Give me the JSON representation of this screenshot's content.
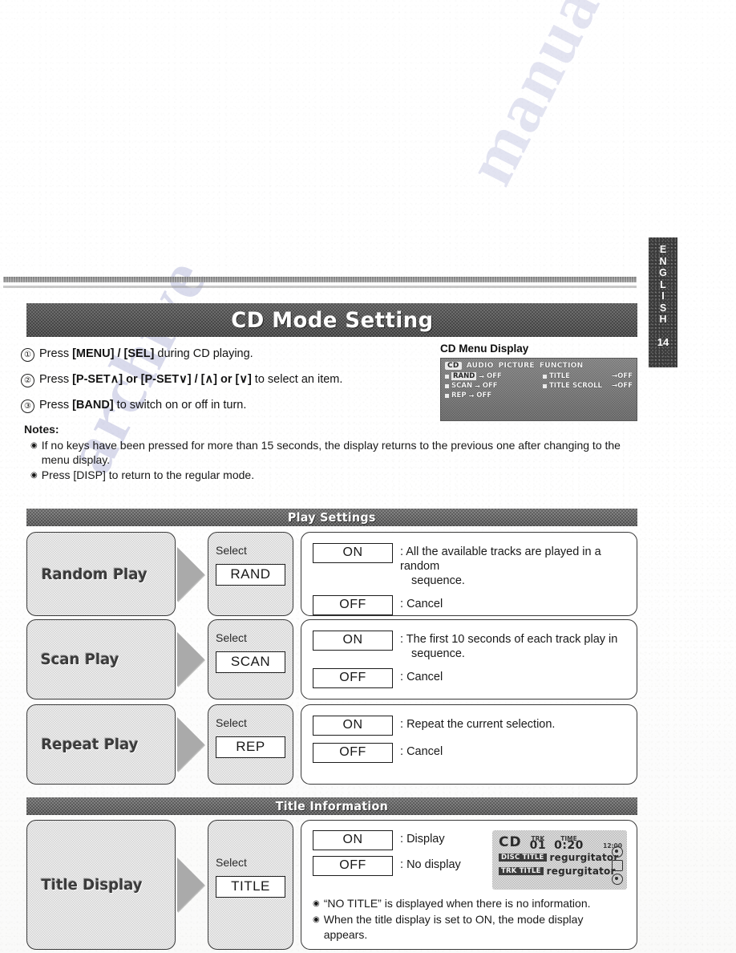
{
  "side_tab": {
    "language": "ENGLISH",
    "letters": [
      "E",
      "N",
      "G",
      "L",
      "I",
      "S",
      "H"
    ],
    "page_number": "14"
  },
  "watermark": {
    "text_left": "archive",
    "text_right": "manualshive.com"
  },
  "header": {
    "title": "CD Mode Setting"
  },
  "steps": [
    {
      "num": "①",
      "pre": "Press ",
      "key1": "[MENU] / [SEL]",
      "post": " during CD playing."
    },
    {
      "num": "②",
      "pre": "Press ",
      "key1": "[P-SET∧] or [P-SET∨] / [∧] or [∨]",
      "post": " to select an item."
    },
    {
      "num": "③",
      "pre": "Press ",
      "key1": "[BAND]",
      "post": " to switch on or off in turn."
    }
  ],
  "cd_menu_display": {
    "title": "CD Menu Display",
    "tabs": [
      "CD",
      "AUDIO",
      "PICTURE",
      "FUNCTION"
    ],
    "selected_tab": "CD",
    "left_items": [
      {
        "label": "RAND",
        "arrow": "→",
        "value": "OFF",
        "highlighted": true
      },
      {
        "label": "SCAN",
        "arrow": "→",
        "value": "OFF",
        "highlighted": false
      },
      {
        "label": "REP",
        "arrow": "→",
        "value": "OFF",
        "highlighted": false
      }
    ],
    "right_items": [
      {
        "label": "TITLE",
        "arrow": "→",
        "value": "OFF",
        "highlighted": false
      },
      {
        "label": "TITLE SCROLL",
        "arrow": "→",
        "value": "OFF",
        "highlighted": false
      }
    ]
  },
  "notes": {
    "heading": "Notes:",
    "items": [
      "If no keys have been pressed for more than 15 seconds, the display returns to the previous one after changing to the menu display.",
      "Press [DISP] to return to the regular mode."
    ]
  },
  "sections": {
    "play_settings": {
      "bar_label": "Play Settings",
      "rows": [
        {
          "name": "Random Play",
          "select_label": "Select",
          "select_code": "RAND",
          "options": [
            {
              "label": "ON",
              "desc": "All the available tracks are played in a random",
              "desc_cont": "sequence."
            },
            {
              "label": "OFF",
              "desc": "Cancel",
              "desc_cont": ""
            }
          ]
        },
        {
          "name": "Scan Play",
          "select_label": "Select",
          "select_code": "SCAN",
          "options": [
            {
              "label": "ON",
              "desc": "The first 10 seconds of each track play in",
              "desc_cont": "sequence."
            },
            {
              "label": "OFF",
              "desc": "Cancel",
              "desc_cont": ""
            }
          ]
        },
        {
          "name": "Repeat Play",
          "select_label": "Select",
          "select_code": "REP",
          "options": [
            {
              "label": "ON",
              "desc": "Repeat the current selection.",
              "desc_cont": ""
            },
            {
              "label": "OFF",
              "desc": "Cancel",
              "desc_cont": ""
            }
          ]
        }
      ]
    },
    "title_information": {
      "bar_label": "Title Information",
      "row": {
        "name": "Title Display",
        "select_label": "Select",
        "select_code": "TITLE",
        "options": [
          {
            "label": "ON",
            "desc": "Display"
          },
          {
            "label": "OFF",
            "desc": "No display"
          }
        ],
        "cd_status_display": {
          "logo": "CD",
          "track_key": "TRK",
          "track_value": "01",
          "time_key": "TIME",
          "time_value": "0:20",
          "clock": "12:00",
          "disc_title_tag": "DISC TITLE",
          "disc_title_value": "regurgitator",
          "track_title_tag": "TRK TITLE",
          "track_title_value": "regurgitator"
        },
        "notes": [
          "“NO TITLE” is displayed when there is no information.",
          "When the title display is set to ON, the mode display appears."
        ]
      }
    }
  },
  "colors": {
    "banner_dark": "#4a4a4a",
    "page_bg": "#ffffff",
    "watermark": "#8f93c9"
  }
}
